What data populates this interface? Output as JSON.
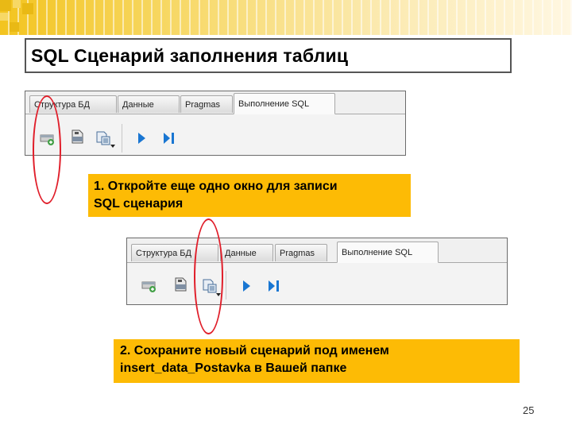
{
  "slide": {
    "title": "SQL Сценарий заполнения таблиц",
    "page_number": "25"
  },
  "screenshot_top": {
    "tabs": [
      "Структура БД",
      "Данные",
      "Pragmas",
      "Выполнение SQL"
    ],
    "active_tab": "Выполнение SQL",
    "toolbar_icons": [
      "open-tab-icon",
      "open-sql-icon",
      "save-sql-icon",
      "execute-all-icon",
      "execute-line-icon"
    ]
  },
  "screenshot_bottom": {
    "tabs": [
      "Структура БД",
      "Данные",
      "Pragmas",
      "Выполнение SQL"
    ],
    "active_tab": "Выполнение SQL",
    "toolbar_icons": [
      "open-tab-icon",
      "open-sql-icon",
      "save-sql-icon",
      "execute-all-icon",
      "execute-line-icon"
    ]
  },
  "notes": {
    "step1": {
      "line1": "1. Откройте еще одно окно для записи",
      "line2": "SQL сценария"
    },
    "step2": {
      "line1": "2. Сохраните новый сценарий под именем",
      "line2": "insert_data_Postavka  в Вашей папке"
    }
  },
  "colors": {
    "note_background": "#fdbb05",
    "highlight_ring": "#e01e2a",
    "header_gold": "#f3c41f"
  }
}
